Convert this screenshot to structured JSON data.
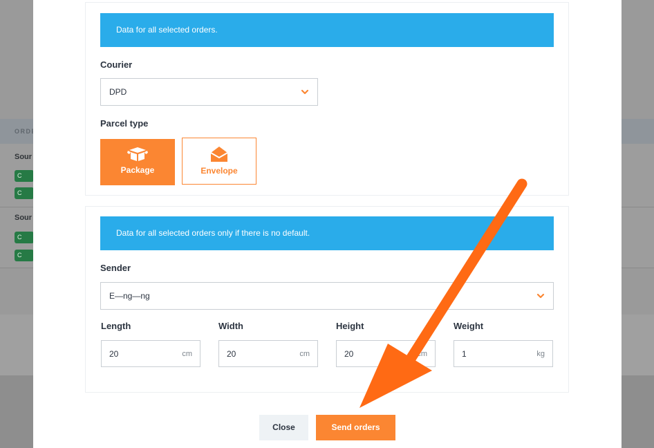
{
  "background": {
    "table_header": "ORDE",
    "rows": [
      {
        "source": "Sour",
        "badges": [
          "C",
          "C"
        ]
      },
      {
        "source": "Sour",
        "badges": [
          "C",
          "C"
        ]
      }
    ]
  },
  "section_courier": {
    "info": "Data for all selected orders.",
    "courier_label": "Courier",
    "courier_value": "DPD",
    "parcel_label": "Parcel type",
    "parcel_types": [
      {
        "label": "Package",
        "icon": "package-icon",
        "selected": true
      },
      {
        "label": "Envelope",
        "icon": "envelope-icon",
        "selected": false
      }
    ]
  },
  "section_sender": {
    "info": "Data for all selected orders only if there is no default.",
    "sender_label": "Sender",
    "sender_value": "E—ng—ng",
    "dimensions": [
      {
        "label": "Length",
        "value": "20",
        "unit": "cm"
      },
      {
        "label": "Width",
        "value": "20",
        "unit": "cm"
      },
      {
        "label": "Height",
        "value": "20",
        "unit": "cm"
      },
      {
        "label": "Weight",
        "value": "1",
        "unit": "kg"
      }
    ]
  },
  "footer": {
    "close_label": "Close",
    "send_label": "Send orders"
  },
  "colors": {
    "accent": "#fb8632",
    "info_bar": "#2aacea",
    "annotation_arrow": "#ff6a14"
  }
}
